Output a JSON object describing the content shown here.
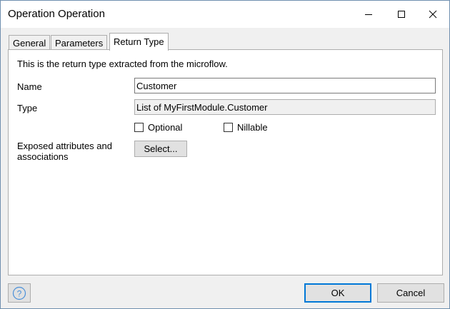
{
  "window": {
    "title": "Operation Operation"
  },
  "tabs": [
    {
      "label": "General"
    },
    {
      "label": "Parameters"
    },
    {
      "label": "Return Type"
    }
  ],
  "active_tab": "Return Type",
  "panel": {
    "intro": "This is the return type extracted from the microflow.",
    "name_label": "Name",
    "name_value": "Customer",
    "type_label": "Type",
    "type_value": "List of MyFirstModule.Customer",
    "optional_label": "Optional",
    "optional_checked": false,
    "nillable_label": "Nillable",
    "nillable_checked": false,
    "exposed_label_line1": "Exposed attributes and",
    "exposed_label_line2": "associations",
    "select_button": "Select..."
  },
  "footer": {
    "ok_label": "OK",
    "cancel_label": "Cancel"
  },
  "icons": {
    "help": "help-icon",
    "minimize": "minimize-icon",
    "maximize": "maximize-icon",
    "close": "close-icon"
  },
  "colors": {
    "accent": "#0078d7",
    "help_icon": "#4a90d9"
  }
}
